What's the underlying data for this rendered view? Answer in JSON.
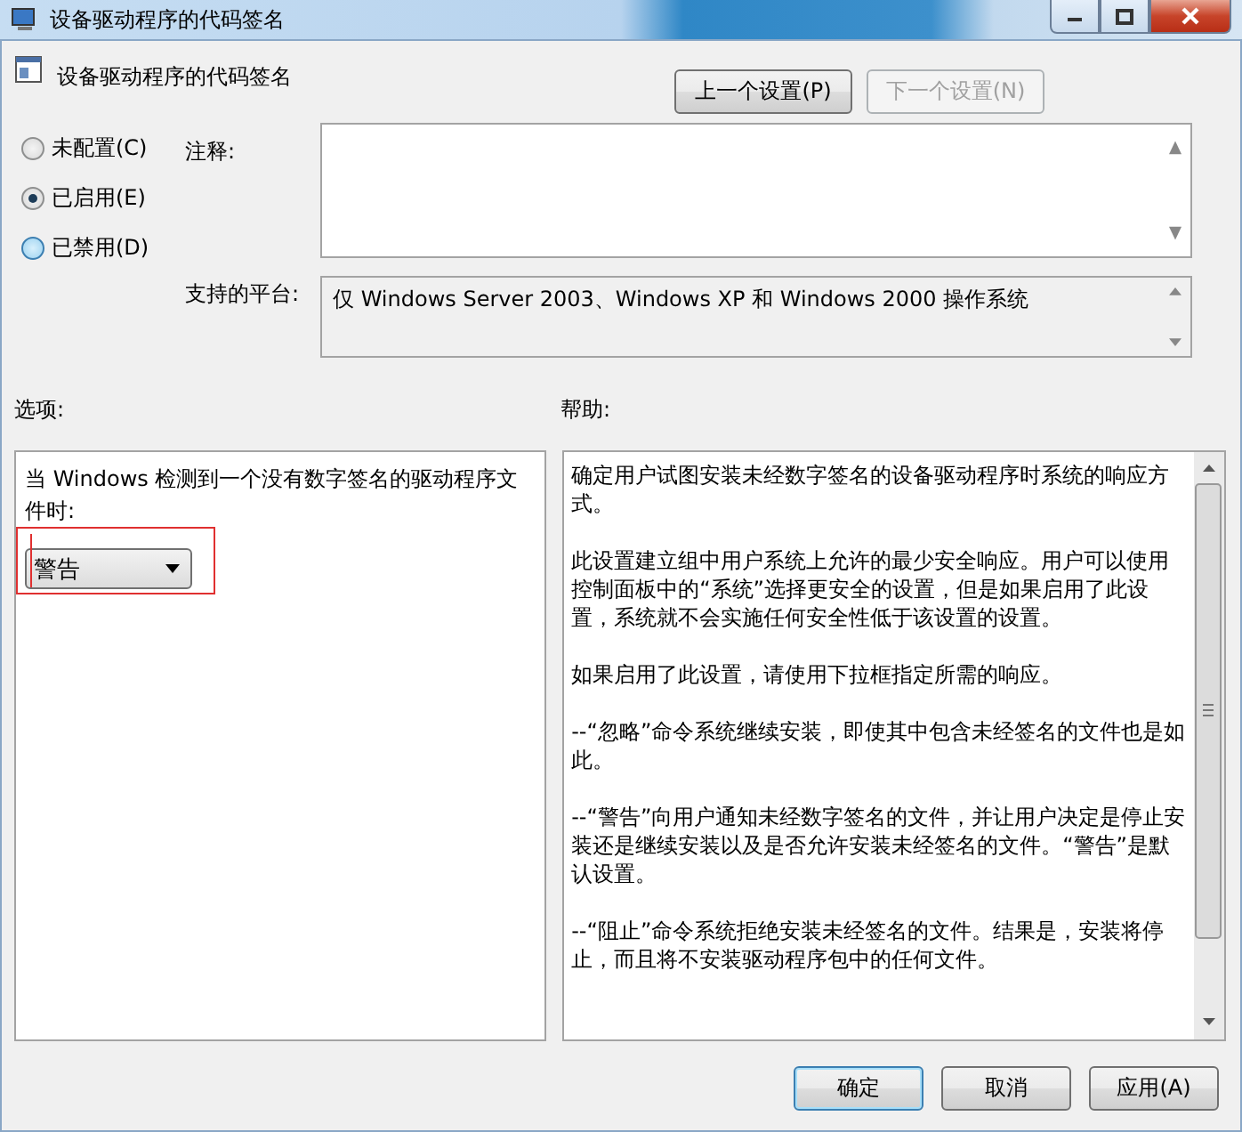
{
  "window": {
    "title": "设备驱动程序的代码签名"
  },
  "header": {
    "title": "设备驱动程序的代码签名",
    "buttons": [
      {
        "label": "上一个设置(P)",
        "disabled": false
      },
      {
        "label": "下一个设置(N)",
        "disabled": true
      }
    ]
  },
  "state_options": [
    {
      "label": "未配置(C)",
      "selected": false
    },
    {
      "label": "已启用(E)",
      "selected": true
    },
    {
      "label": "已禁用(D)",
      "selected": false
    }
  ],
  "comment": {
    "label": "注释:"
  },
  "platform": {
    "label": "支持的平台:",
    "value": "仅 Windows Server 2003、Windows XP 和 Windows 2000 操作系统"
  },
  "options": {
    "heading": "选项:",
    "prompt": "当 Windows 检测到一个没有数字签名的驱动程序文件时:",
    "dropdown": "警告"
  },
  "help": {
    "heading": "帮助:",
    "paragraphs": [
      "确定用户试图安装未经数字签名的设备驱动程序时系统的响应方式。",
      "此设置建立组中用户系统上允许的最少安全响应。用户可以使用控制面板中的“系统”选择更安全的设置，但是如果启用了此设置，系统就不会实施任何安全性低于该设置的设置。",
      "如果启用了此设置，请使用下拉框指定所需的响应。",
      "--“忽略”命令系统继续安装，即使其中包含未经签名的文件也是如此。",
      "--“警告”向用户通知未经数字签名的文件，并让用户决定是停止安装还是继续安装以及是否允许安装未经签名的文件。“警告”是默认设置。",
      "--“阻止”命令系统拒绝安装未经签名的文件。结果是，安装将停止，而且将不安装驱动程序包中的任何文件。"
    ]
  },
  "buttons": [
    {
      "label": "确定",
      "default": true
    },
    {
      "label": "取消",
      "default": false
    },
    {
      "label": "应用(A)",
      "default": false
    }
  ]
}
